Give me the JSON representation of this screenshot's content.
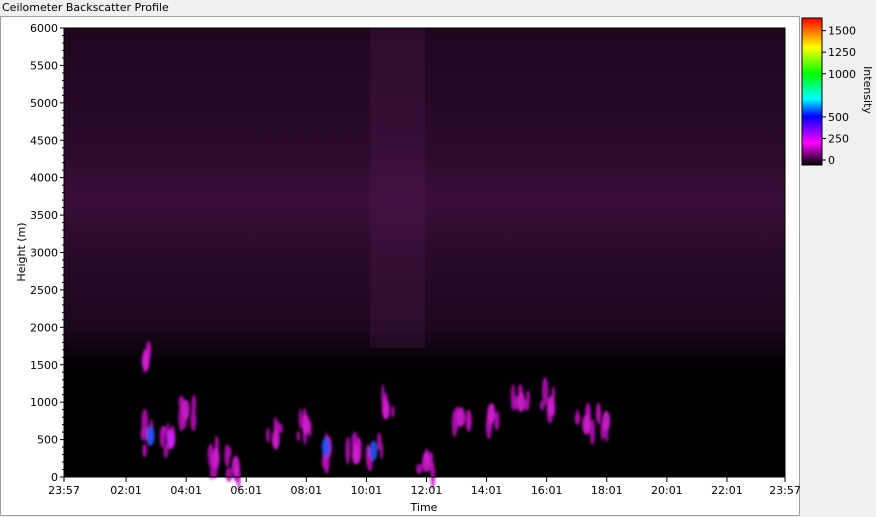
{
  "window": {
    "title": "Ceilometer Backscatter Profile"
  },
  "chart_data": {
    "type": "heatmap",
    "title": "",
    "xlabel": "Time",
    "ylabel": "Height (m)",
    "x_ticks": [
      "23:57",
      "02:01",
      "04:01",
      "06:01",
      "08:01",
      "10:01",
      "12:01",
      "14:01",
      "16:01",
      "18:01",
      "20:01",
      "22:01",
      "23:57"
    ],
    "y_ticks": [
      0,
      500,
      1000,
      1500,
      2000,
      2500,
      3000,
      3500,
      4000,
      4500,
      5000,
      5500,
      6000
    ],
    "ylim": [
      0,
      6000
    ],
    "grid": false,
    "colorbar": {
      "label": "Intensity",
      "ticks": [
        0,
        250,
        500,
        1000,
        1250,
        1500
      ],
      "range": [
        0,
        1600
      ],
      "colors": [
        "#000000",
        "#ff00ff",
        "#0000ff",
        "#00ffff",
        "#00ff00",
        "#ffff00",
        "#ff0000"
      ]
    },
    "background_levels": [
      {
        "height_range": [
          0,
          1500
        ],
        "intensity": 0
      },
      {
        "height_range": [
          1500,
          2000
        ],
        "intensity": 40
      },
      {
        "height_range": [
          2000,
          3000
        ],
        "intensity": 80
      },
      {
        "height_range": [
          3000,
          4300
        ],
        "intensity": 95
      },
      {
        "height_range": [
          4300,
          6000
        ],
        "intensity": 60
      }
    ],
    "features": [
      {
        "time": "02:40",
        "height": 1550,
        "intensity": 260
      },
      {
        "time": "02:50",
        "height": 550,
        "intensity": 520
      },
      {
        "time": "03:30",
        "height": 500,
        "intensity": 480
      },
      {
        "time": "04:00",
        "height": 900,
        "intensity": 260
      },
      {
        "time": "05:00",
        "height": 250,
        "intensity": 300
      },
      {
        "time": "05:40",
        "height": 150,
        "intensity": 260
      },
      {
        "time": "07:00",
        "height": 500,
        "intensity": 260
      },
      {
        "time": "08:00",
        "height": 700,
        "intensity": 260
      },
      {
        "time": "08:40",
        "height": 400,
        "intensity": 520
      },
      {
        "time": "09:40",
        "height": 300,
        "intensity": 260
      },
      {
        "time": "10:15",
        "height": 350,
        "intensity": 560
      },
      {
        "time": "10:40",
        "height": 900,
        "intensity": 260
      },
      {
        "time": "12:00",
        "height": 200,
        "intensity": 300
      },
      {
        "time": "13:10",
        "height": 800,
        "intensity": 260
      },
      {
        "time": "14:10",
        "height": 850,
        "intensity": 260
      },
      {
        "time": "15:10",
        "height": 1000,
        "intensity": 280
      },
      {
        "time": "16:10",
        "height": 950,
        "intensity": 280
      },
      {
        "time": "17:20",
        "height": 700,
        "intensity": 260
      },
      {
        "time": "18:00",
        "height": 750,
        "intensity": 260
      }
    ]
  }
}
